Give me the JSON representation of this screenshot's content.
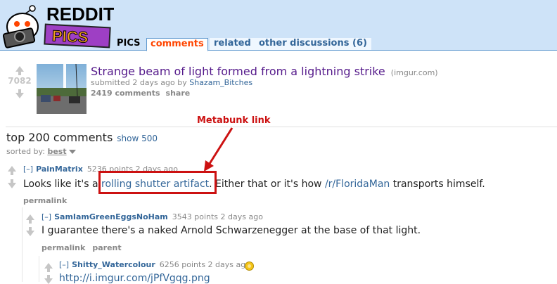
{
  "header": {
    "logo_top": "REDDIT",
    "logo_bottom": "PICS",
    "tabs": [
      {
        "label": "PICS"
      },
      {
        "label": "comments"
      },
      {
        "label": "related"
      },
      {
        "label": "other discussions (6)"
      }
    ]
  },
  "post": {
    "score": "7082",
    "title": "Strange beam of light formed from a lightning strike",
    "domain": "(imgur.com)",
    "tagline_prefix": "submitted 2 days ago by",
    "author": "Shazam_Bitches",
    "comments_link": "2419 comments",
    "share_link": "share"
  },
  "comments_header": {
    "title": "top 200 comments",
    "show_more": "show 500",
    "sorted_label": "sorted by:",
    "sorted_value": "best"
  },
  "annotation": {
    "label": "Metabunk link",
    "color": "#cc1111"
  },
  "comments": [
    {
      "toggle": "[–]",
      "user": "PainMatrix",
      "meta": "5236 points 2 days ago",
      "body_prefix": "Looks like it's a",
      "link_text": "rolling shutter artifact",
      "body_mid": ". Either that or it's how",
      "link2_text": "/r/FloridaMan",
      "body_suffix": "transports himself.",
      "buttons": [
        "permalink"
      ]
    },
    {
      "toggle": "[–]",
      "user": "SamIamGreenEggsNoHam",
      "meta": "3543 points 2 days ago",
      "body": "I guarantee there's a naked Arnold Schwarzenegger at the base of that light.",
      "buttons": [
        "permalink",
        "parent"
      ]
    },
    {
      "toggle": "[–]",
      "user": "Shitty_Watercolour",
      "meta": "6256 points 2 days ago",
      "body_link": "http://i.imgur.com/jPfVgqg.png"
    }
  ],
  "colors": {
    "header_bg": "#cee3f8",
    "link_blue": "#336699",
    "tab_selected": "#ff4500",
    "title_visited": "#551a8b"
  }
}
